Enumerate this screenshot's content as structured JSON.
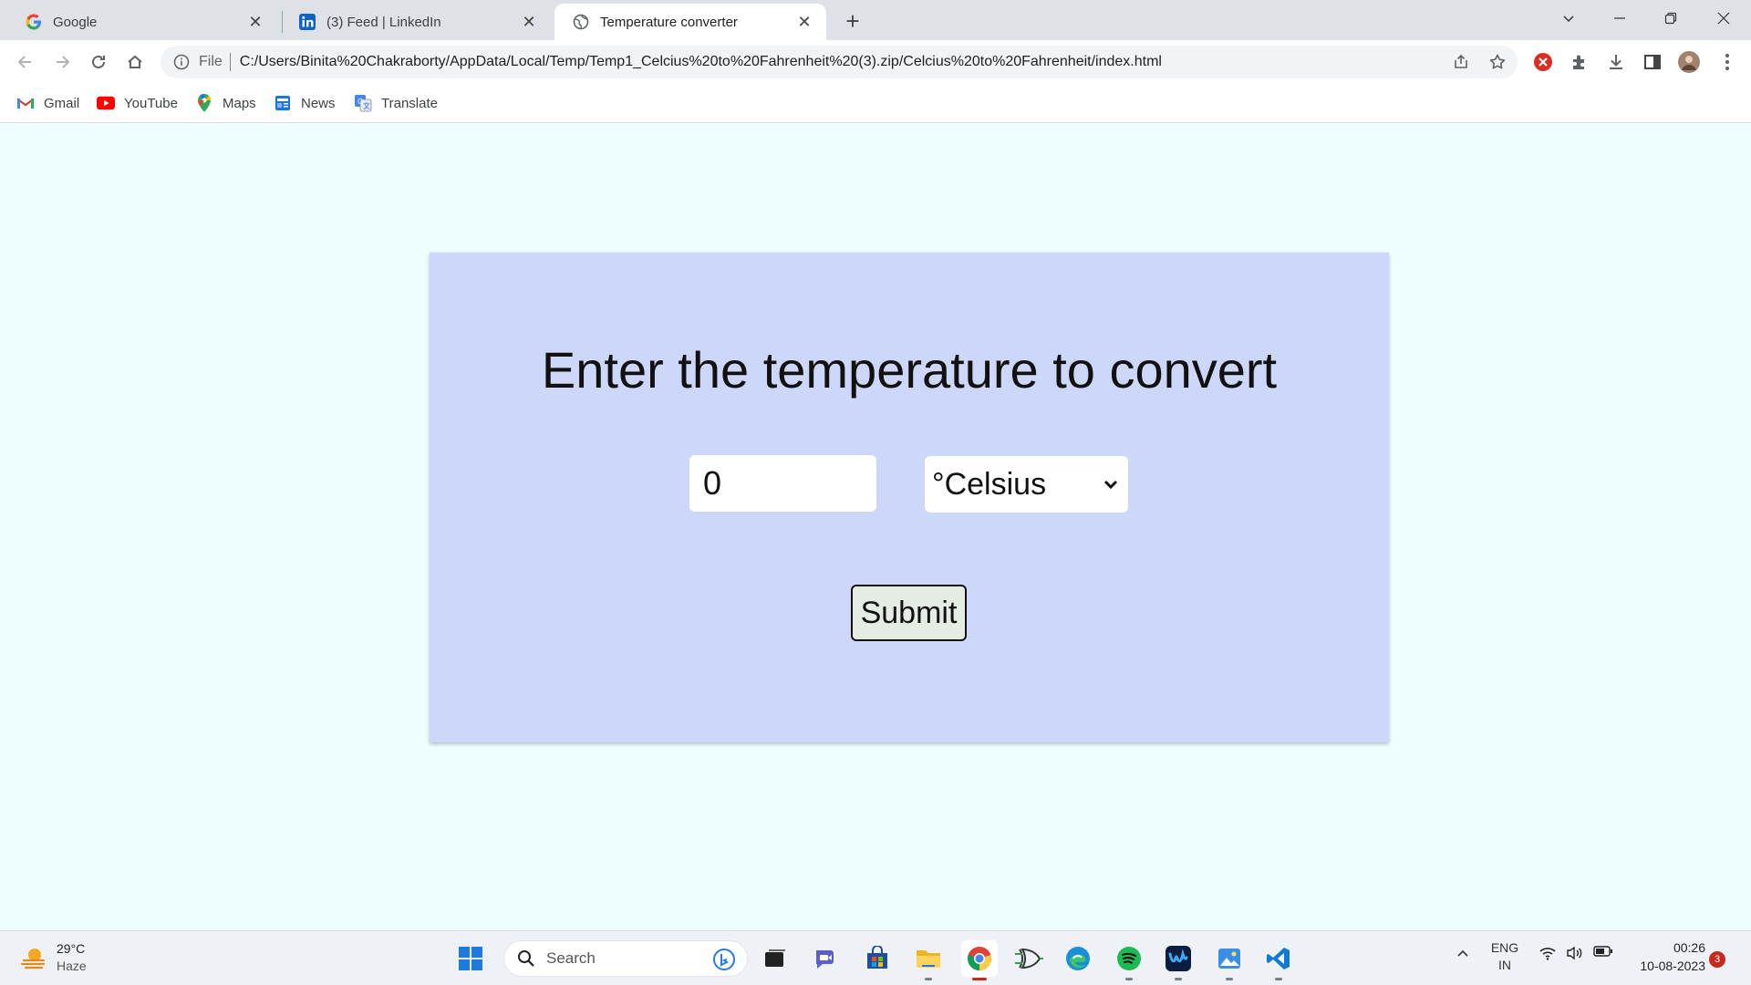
{
  "tabs": [
    {
      "title": "Google",
      "icon": "google-icon",
      "active": false
    },
    {
      "title": "(3) Feed | LinkedIn",
      "icon": "linkedin-icon",
      "active": false
    },
    {
      "title": "Temperature converter",
      "icon": "globe-icon",
      "active": true
    }
  ],
  "address": {
    "scheme_label": "File",
    "url": "C:/Users/Binita%20Chakraborty/AppData/Local/Temp/Temp1_Celcius%20to%20Fahrenheit%20(3).zip/Celcius%20to%20Fahrenheit/index.html"
  },
  "bookmarks": [
    {
      "label": "Gmail",
      "icon": "gmail-icon"
    },
    {
      "label": "YouTube",
      "icon": "youtube-icon"
    },
    {
      "label": "Maps",
      "icon": "maps-icon"
    },
    {
      "label": "News",
      "icon": "news-icon"
    },
    {
      "label": "Translate",
      "icon": "translate-icon"
    }
  ],
  "page": {
    "heading": "Enter the temperature to convert",
    "temperature_value": "0",
    "unit_selected": "°Celsius",
    "submit_label": "Submit",
    "background_color": "#eefefe",
    "card_color": "#ccd7fa"
  },
  "taskbar": {
    "weather_temp": "29°C",
    "weather_desc": "Haze",
    "search_label": "Search",
    "language": "ENG",
    "region": "IN",
    "time": "00:26",
    "date": "10-08-2023",
    "notification_count": "3"
  }
}
